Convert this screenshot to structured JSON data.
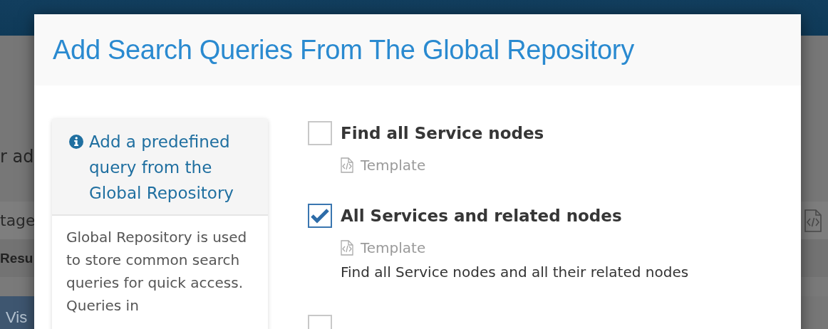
{
  "background": {
    "text": "r ad",
    "row_label": "tage",
    "column_header": "Resu",
    "button": "Vis"
  },
  "dialog": {
    "title": "Add Search Queries From The Global Repository",
    "info_panel": {
      "heading": "Add a predefined query from the Global Repository",
      "body": "Global Repository is used to store common search queries for quick access. Queries in"
    },
    "queries": [
      {
        "title": "Find all Service nodes",
        "checked": false,
        "type": "Template"
      },
      {
        "title": "All Services and related nodes",
        "checked": true,
        "type": "Template",
        "description": "Find all Service nodes and all their related nodes"
      },
      {
        "checked": false
      }
    ]
  }
}
